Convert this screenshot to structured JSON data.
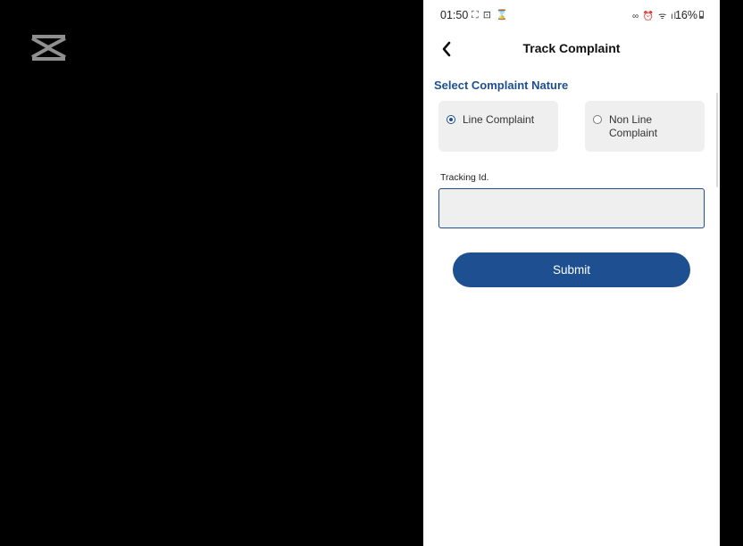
{
  "status_bar": {
    "time": "01:50",
    "left_icons": "⛶ ⊡ ⌛",
    "right_icons": "∞ ⏰ ᯤ ıl",
    "battery": "16%"
  },
  "header": {
    "title": "Track Complaint",
    "back_icon": "chevron-left-icon"
  },
  "form": {
    "section_title": "Select Complaint Nature",
    "options": [
      {
        "label": "Line Complaint",
        "selected": true
      },
      {
        "label": "Non Line Complaint",
        "selected": false
      }
    ],
    "tracking_label": "Tracking Id.",
    "tracking_value": "",
    "submit_label": "Submit"
  },
  "colors": {
    "accent": "#1d4f91",
    "card_bg": "#efefef",
    "background": "#000000"
  }
}
